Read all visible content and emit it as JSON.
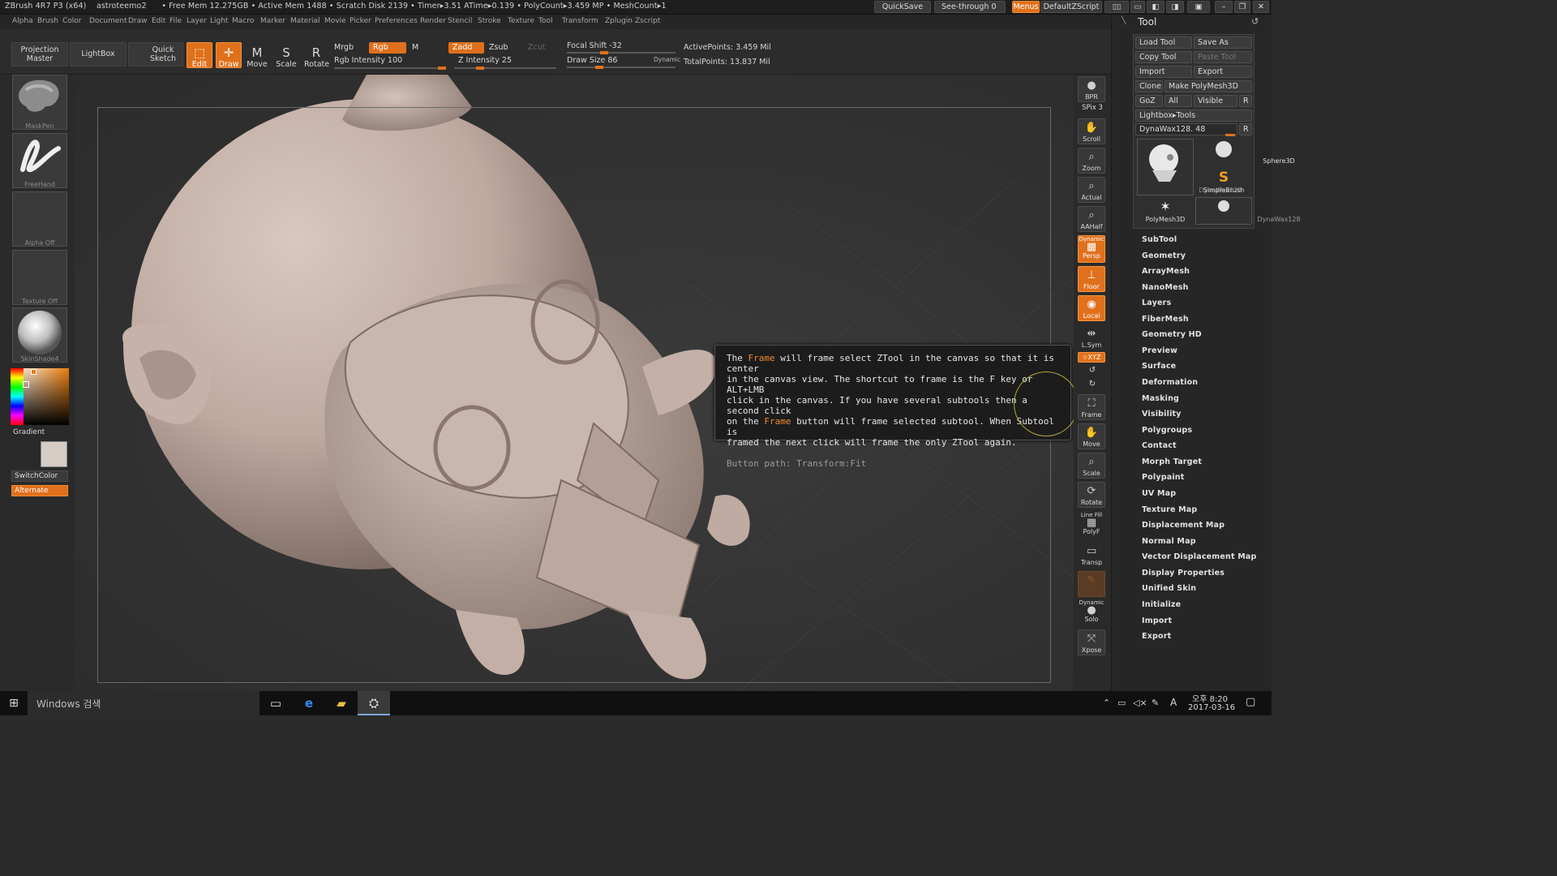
{
  "titlebar": {
    "app": "ZBrush 4R7 P3 (x64)",
    "user": "astroteemo2",
    "stats": "• Free Mem 12.275GB • Active Mem 1488 • Scratch Disk 2139 • Timer▸3.51 ATime▸0.139 • PolyCount▸3.459 MP • MeshCount▸1",
    "quicksave": "QuickSave",
    "seethrough": "See-through  0",
    "menus": "Menus",
    "defaultzscript": "DefaultZScript"
  },
  "menu": [
    "Alpha",
    "Brush",
    "Color",
    "Document",
    "Draw",
    "Edit",
    "File",
    "Layer",
    "Light",
    "Macro",
    "Marker",
    "Material",
    "Movie",
    "Picker",
    "Preferences",
    "Render",
    "Stencil",
    "Stroke",
    "Texture",
    "Tool",
    "Transform",
    "Zplugin",
    "Zscript"
  ],
  "shelf": {
    "projection_master": "Projection Master",
    "lightbox": "LightBox",
    "quick_sketch": "Quick Sketch",
    "edit": "Edit",
    "draw": "Draw",
    "move": "Move",
    "scale": "Scale",
    "rotate": "Rotate",
    "mrgb": "Mrgb",
    "rgb": "Rgb",
    "m": "M",
    "rgb_intensity": "Rgb Intensity 100",
    "zadd": "Zadd",
    "zsub": "Zsub",
    "zcut": "Zcut",
    "z_intensity": "Z Intensity 25",
    "focal_shift": "Focal Shift -32",
    "draw_size": "Draw Size 86",
    "dynamic": "Dynamic",
    "active_points": "ActivePoints: 3.459  Mil",
    "total_points": "TotalPoints: 13.837  Mil",
    "rgb_intensity_level": 100,
    "z_intensity_level": 25,
    "focal_shift_level": -32,
    "draw_size_level": 86
  },
  "lefttray": {
    "brush": "MaskPen",
    "stroke": "FreeHand",
    "alpha": "Alpha  Off",
    "texture": "Texture  Off",
    "material": "SkinShade4",
    "gradient": "Gradient",
    "switchcolor": "SwitchColor",
    "alternate": "Alternate"
  },
  "tooltip": {
    "l1a": "The ",
    "l1b": "Frame",
    "l1c": " will frame select ZTool in the canvas so that it is center",
    "l2": "in the canvas view. The shortcut to frame is the F key or ALT+LMB",
    "l3": "click in the canvas. If you have several subtools then a second click",
    "l4a": "on the ",
    "l4b": "Frame",
    "l4c": " button will frame selected subtool. When Subtool is",
    "l5": "framed the next click will frame the only ZTool again.",
    "path": "Button path: Transform:Fit"
  },
  "rightstrip": {
    "bpr": "BPR",
    "spix": "SPix 3",
    "scroll": "Scroll",
    "zoom": "Zoom",
    "actual": "Actual",
    "aahalf": "AAHalf",
    "dynamic": "Dynamic",
    "persp": "Persp",
    "floor": "Floor",
    "local": "Local",
    "lsym": "L.Sym",
    "xyz": "☆XYZ",
    "frame": "Frame",
    "move": "Move",
    "scale": "Scale",
    "rotate": "Rotate",
    "linefill": "Line Fill",
    "polyf": "PolyF",
    "transp": "Transp",
    "dynamic2": "Dynamic",
    "solo": "Solo",
    "xpose": "Xpose"
  },
  "toolpanel": {
    "title": "Tool",
    "load_tool": "Load Tool",
    "save_as": "Save As",
    "copy_tool": "Copy Tool",
    "paste_tool": "Paste Tool",
    "import": "Import",
    "export": "Export",
    "clone": "Clone",
    "make_polymesh": "Make PolyMesh3D",
    "goz": "GoZ",
    "all": "All",
    "visible": "Visible",
    "r": "R",
    "lightbox_tools": "Lightbox▸Tools",
    "current_tool": "DynaWax128. 48",
    "r2": "R",
    "thumbs": [
      "DynaWax128",
      "Sphere3D",
      "SimpleBrush",
      "PolyMesh3D",
      "DynaWax128"
    ],
    "sections": [
      "SubTool",
      "Geometry",
      "ArrayMesh",
      "NanoMesh",
      "Layers",
      "FiberMesh",
      "Geometry HD",
      "Preview",
      "Surface",
      "Deformation",
      "Masking",
      "Visibility",
      "Polygroups",
      "Contact",
      "Morph Target",
      "Polypaint",
      "UV Map",
      "Texture Map",
      "Displacement Map",
      "Normal Map",
      "Vector Displacement Map",
      "Display Properties",
      "Unified Skin",
      "Initialize",
      "Import",
      "Export"
    ]
  },
  "taskbar": {
    "search": "Windows 검색",
    "time": "오후 8:20",
    "date": "2017-03-16",
    "ime": "A"
  }
}
